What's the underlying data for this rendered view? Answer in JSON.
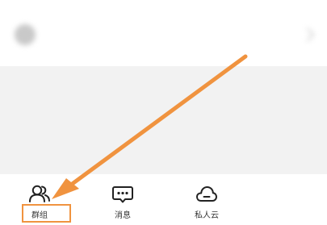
{
  "header": {
    "blurred_label": "",
    "icon": "settings-circle-icon"
  },
  "tabbar": {
    "tabs": [
      {
        "label": "群组",
        "icon": "group-users-icon"
      },
      {
        "label": "消息",
        "icon": "message-chat-icon"
      },
      {
        "label": "私人云",
        "icon": "private-cloud-icon"
      }
    ]
  },
  "annotation": {
    "color": "#f0933f",
    "target": "tab-group"
  }
}
